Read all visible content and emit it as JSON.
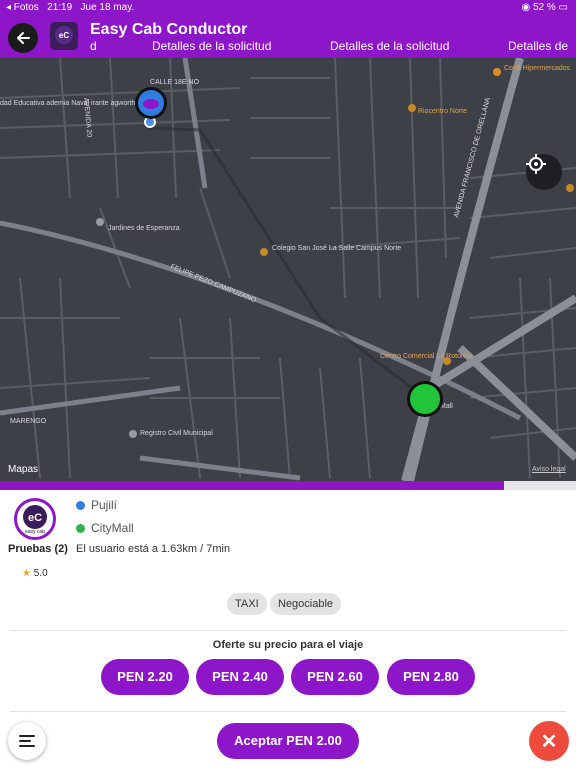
{
  "status_bar": {
    "back_app": "◂ Fotos",
    "time": "21:19",
    "date": "Jue 18 may.",
    "battery": "52 %"
  },
  "header": {
    "title": "Easy Cab Conductor",
    "marquee": [
      "d",
      "Detalles de la solicitud",
      "Detalles de la solicitud",
      "Detalles de"
    ],
    "logo_text": "easy cab"
  },
  "map": {
    "labels": {
      "calle_18e": "CALLE 18E NO",
      "avenida_x": "AVENIDA 20",
      "jardines": "Jardines de Esperanza",
      "colegio": "Colegio San José La Salle Campus Norte",
      "felipe": "FELIPE PEZO CAMPUZANO",
      "centro": "Centro Comercial La Rotonda",
      "registro": "Registro Civil Municipal",
      "riocentro": "Riocentro Norte",
      "coral": "Coral Hipermercados",
      "unidad": "dad Educativa ademia Naval irante agworth",
      "avenida_orellana": "AVENIDA FRANCISCO DE ORELLANA",
      "marengo": "MARENGO",
      "mall": "Mall"
    },
    "brand": "Mapas",
    "legal": "Aviso legal"
  },
  "progress": {
    "fraction": 0.875
  },
  "passenger": {
    "name": "Pruebas (2)",
    "rating": "5.0",
    "origin": "Pujilí",
    "destination": "CityMall",
    "eta": "El usuario está a 1.63km / 7min"
  },
  "tags": [
    "TAXI",
    "Negociable"
  ],
  "offer": {
    "title": "Oferte su precio para el viaje",
    "prices": [
      "PEN 2.20",
      "PEN 2.40",
      "PEN 2.60",
      "PEN 2.80"
    ]
  },
  "accept_label": "Aceptar PEN 2.00",
  "colors": {
    "brand": "#8e16c9",
    "origin_dot": "#2f7de1",
    "destination_dot": "#2fb24b",
    "close": "#ee4b3f"
  }
}
